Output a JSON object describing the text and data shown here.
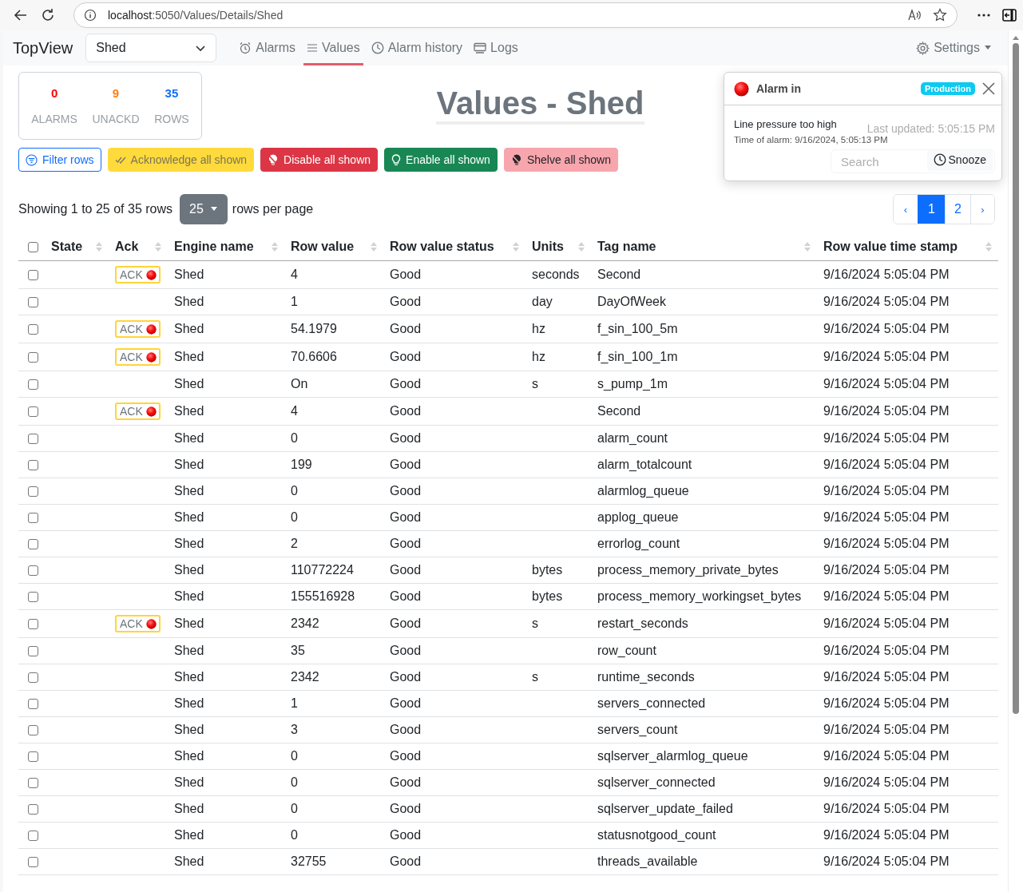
{
  "browser": {
    "url_host": "localhost",
    "url_rest": ":5050/Values/Details/Shed"
  },
  "navbar": {
    "brand": "TopView",
    "engine_select": "Shed",
    "tabs": [
      {
        "label": "Alarms",
        "kind": "alarm",
        "selected": false
      },
      {
        "label": "Values",
        "kind": "list",
        "selected": true
      },
      {
        "label": "Alarm history",
        "kind": "clock",
        "selected": false
      },
      {
        "label": "Logs",
        "kind": "window",
        "selected": false
      }
    ],
    "settings": "Settings"
  },
  "summary": [
    {
      "value": "0",
      "label": "ALARMS",
      "color": "#ff0000"
    },
    {
      "value": "9",
      "label": "UNACKD",
      "color": "#fd7e14"
    },
    {
      "value": "35",
      "label": "ROWS",
      "color": "#0d6efd"
    }
  ],
  "title": "Values - Shed",
  "last_updated": "Last updated: 5:05:15 PM",
  "search": {
    "placeholder": "Search"
  },
  "actions": [
    {
      "label": "Filter rows",
      "kind": "filter"
    },
    {
      "label": "Acknowledge all shown",
      "kind": "acknowledge"
    },
    {
      "label": "Disable all shown",
      "kind": "disable"
    },
    {
      "label": "Enable all shown",
      "kind": "enable"
    },
    {
      "label": "Shelve all shown",
      "kind": "shelve"
    }
  ],
  "paging": {
    "showing": "Showing 1 to 25 of 35 rows",
    "page_size": "25",
    "per_page": "rows per page",
    "pages": [
      {
        "label": "‹",
        "kind": "prev",
        "selected": false
      },
      {
        "label": "1",
        "kind": "page",
        "selected": true
      },
      {
        "label": "2",
        "kind": "page",
        "selected": false
      },
      {
        "label": "›",
        "kind": "next",
        "selected": false
      }
    ]
  },
  "table": {
    "select_all_checked": false,
    "columns": [
      "State",
      "Ack",
      "Engine name",
      "Row value",
      "Row value status",
      "Units",
      "Tag name",
      "Row value time stamp"
    ],
    "rows": [
      {
        "checked": false,
        "ack": "ACK",
        "engine": "Shed",
        "value": "4",
        "status": "Good",
        "units": "seconds",
        "tag": "Second",
        "time": "9/16/2024 5:05:04 PM"
      },
      {
        "checked": false,
        "engine": "Shed",
        "value": "1",
        "status": "Good",
        "units": "day",
        "tag": "DayOfWeek",
        "time": "9/16/2024 5:05:04 PM"
      },
      {
        "checked": false,
        "ack": "ACK",
        "engine": "Shed",
        "value": "54.1979",
        "status": "Good",
        "units": "hz",
        "tag": "f_sin_100_5m",
        "time": "9/16/2024 5:05:04 PM"
      },
      {
        "checked": false,
        "ack": "ACK",
        "engine": "Shed",
        "value": "70.6606",
        "status": "Good",
        "units": "hz",
        "tag": "f_sin_100_1m",
        "time": "9/16/2024 5:05:04 PM"
      },
      {
        "checked": false,
        "engine": "Shed",
        "value": "On",
        "status": "Good",
        "units": "s",
        "tag": "s_pump_1m",
        "time": "9/16/2024 5:05:04 PM"
      },
      {
        "checked": false,
        "ack": "ACK",
        "engine": "Shed",
        "value": "4",
        "status": "Good",
        "tag": "Second",
        "time": "9/16/2024 5:05:04 PM"
      },
      {
        "checked": false,
        "engine": "Shed",
        "value": "0",
        "status": "Good",
        "tag": "alarm_count",
        "time": "9/16/2024 5:05:04 PM"
      },
      {
        "checked": false,
        "engine": "Shed",
        "value": "199",
        "status": "Good",
        "tag": "alarm_totalcount",
        "time": "9/16/2024 5:05:04 PM"
      },
      {
        "checked": false,
        "engine": "Shed",
        "value": "0",
        "status": "Good",
        "tag": "alarmlog_queue",
        "time": "9/16/2024 5:05:04 PM"
      },
      {
        "checked": false,
        "engine": "Shed",
        "value": "0",
        "status": "Good",
        "tag": "applog_queue",
        "time": "9/16/2024 5:05:04 PM"
      },
      {
        "checked": false,
        "engine": "Shed",
        "value": "2",
        "status": "Good",
        "tag": "errorlog_count",
        "time": "9/16/2024 5:05:04 PM"
      },
      {
        "checked": false,
        "engine": "Shed",
        "value": "110772224",
        "status": "Good",
        "units": "bytes",
        "tag": "process_memory_private_bytes",
        "time": "9/16/2024 5:05:04 PM"
      },
      {
        "checked": false,
        "engine": "Shed",
        "value": "155516928",
        "status": "Good",
        "units": "bytes",
        "tag": "process_memory_workingset_bytes",
        "time": "9/16/2024 5:05:04 PM"
      },
      {
        "checked": false,
        "ack": "ACK",
        "engine": "Shed",
        "value": "2342",
        "status": "Good",
        "units": "s",
        "tag": "restart_seconds",
        "time": "9/16/2024 5:05:04 PM"
      },
      {
        "checked": false,
        "engine": "Shed",
        "value": "35",
        "status": "Good",
        "tag": "row_count",
        "time": "9/16/2024 5:05:04 PM"
      },
      {
        "checked": false,
        "engine": "Shed",
        "value": "2342",
        "status": "Good",
        "units": "s",
        "tag": "runtime_seconds",
        "time": "9/16/2024 5:05:04 PM"
      },
      {
        "checked": false,
        "engine": "Shed",
        "value": "1",
        "status": "Good",
        "tag": "servers_connected",
        "time": "9/16/2024 5:05:04 PM"
      },
      {
        "checked": false,
        "engine": "Shed",
        "value": "3",
        "status": "Good",
        "tag": "servers_count",
        "time": "9/16/2024 5:05:04 PM"
      },
      {
        "checked": false,
        "engine": "Shed",
        "value": "0",
        "status": "Good",
        "tag": "sqlserver_alarmlog_queue",
        "time": "9/16/2024 5:05:04 PM"
      },
      {
        "checked": false,
        "engine": "Shed",
        "value": "0",
        "status": "Good",
        "tag": "sqlserver_connected",
        "time": "9/16/2024 5:05:04 PM"
      },
      {
        "checked": false,
        "engine": "Shed",
        "value": "0",
        "status": "Good",
        "tag": "sqlserver_update_failed",
        "time": "9/16/2024 5:05:04 PM"
      },
      {
        "checked": false,
        "engine": "Shed",
        "value": "0",
        "status": "Good",
        "tag": "statusnotgood_count",
        "time": "9/16/2024 5:05:04 PM"
      },
      {
        "checked": false,
        "engine": "Shed",
        "value": "32755",
        "status": "Good",
        "tag": "threads_available",
        "time": "9/16/2024 5:05:04 PM"
      }
    ]
  },
  "toast": {
    "title": "Alarm in",
    "badge": "Production",
    "message": "Line pressure too high",
    "time": "Time of alarm: 9/16/2024, 5:05:13 PM",
    "snooze": "Snooze"
  }
}
